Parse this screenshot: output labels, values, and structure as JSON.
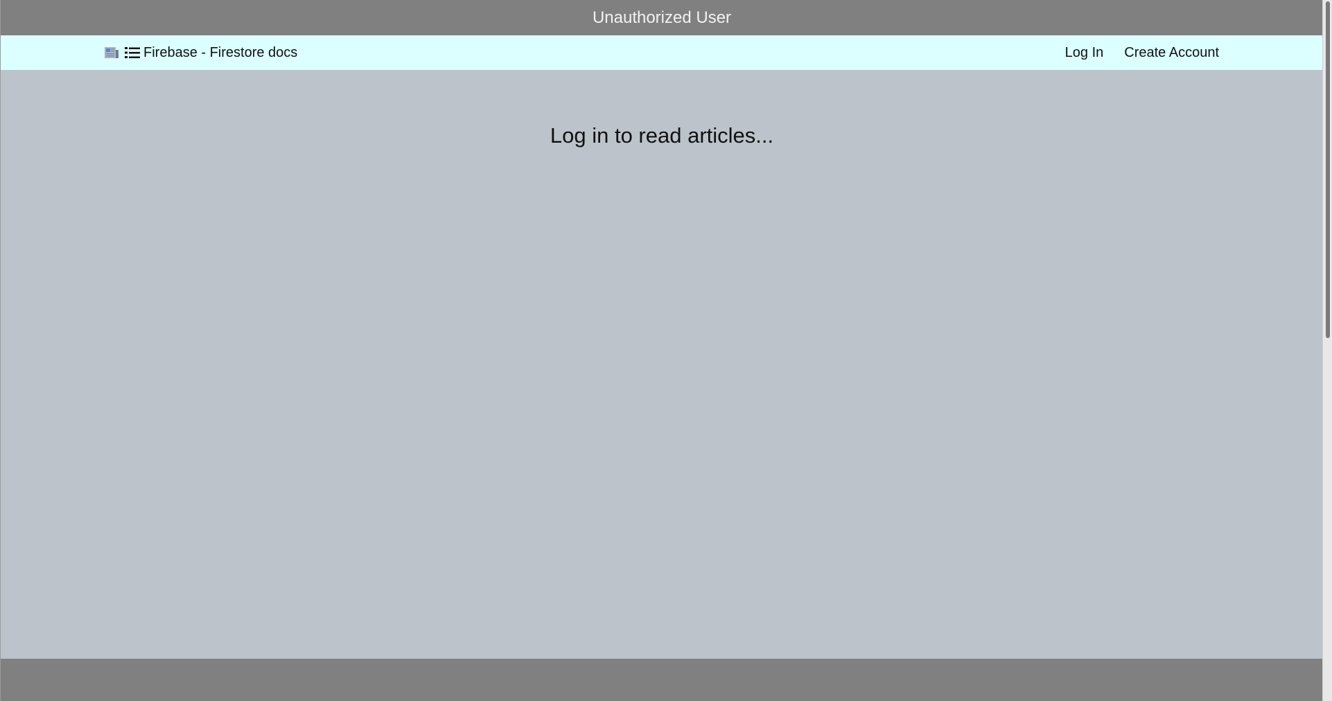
{
  "header": {
    "title": "Unauthorized User"
  },
  "nav": {
    "brand_label": "Firebase - Firestore docs",
    "favicon_icon": "newspaper-icon",
    "brand_icon": "list-icon",
    "links": [
      {
        "label": "Log In"
      },
      {
        "label": "Create Account"
      }
    ]
  },
  "main": {
    "message": "Log in to read articles..."
  },
  "colors": {
    "header_bg": "#808080",
    "nav_bg": "#dcffff",
    "page_bg": "#bcc3cb",
    "footer_bg": "#808080"
  }
}
